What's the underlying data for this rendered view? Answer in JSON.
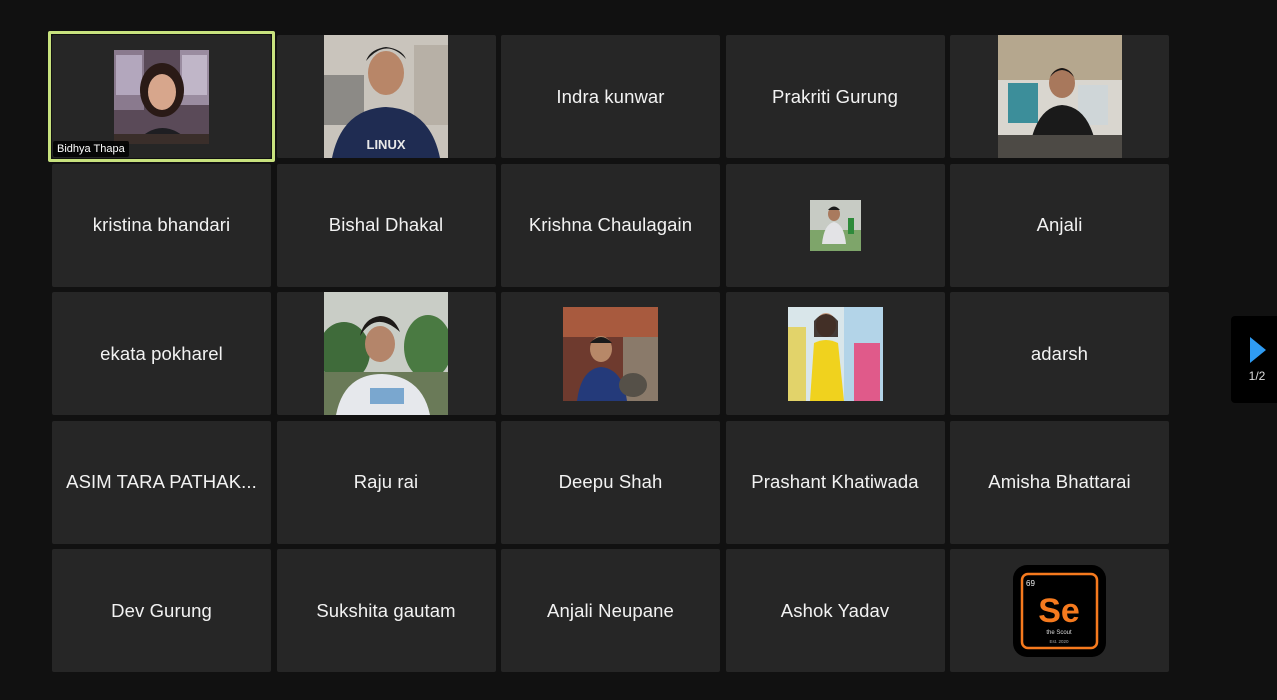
{
  "participants": [
    {
      "name": "Bidhya Thapa",
      "kind": "video",
      "active": true
    },
    {
      "name": "",
      "kind": "photo"
    },
    {
      "name": "Indra kunwar",
      "kind": "name"
    },
    {
      "name": "Prakriti Gurung",
      "kind": "name"
    },
    {
      "name": "",
      "kind": "photo"
    },
    {
      "name": "kristina bhandari",
      "kind": "name"
    },
    {
      "name": "Bishal Dhakal",
      "kind": "name"
    },
    {
      "name": "Krishna Chaulagain",
      "kind": "name"
    },
    {
      "name": "",
      "kind": "photo"
    },
    {
      "name": "Anjali",
      "kind": "name"
    },
    {
      "name": "ekata pokharel",
      "kind": "name"
    },
    {
      "name": "",
      "kind": "photo"
    },
    {
      "name": "",
      "kind": "photo"
    },
    {
      "name": "",
      "kind": "photo"
    },
    {
      "name": "adarsh",
      "kind": "name"
    },
    {
      "name": "ASIM TARA PATHAK...",
      "kind": "name"
    },
    {
      "name": "Raju rai",
      "kind": "name"
    },
    {
      "name": "Deepu Shah",
      "kind": "name"
    },
    {
      "name": "Prashant Khatiwada",
      "kind": "name"
    },
    {
      "name": "Amisha Bhattarai",
      "kind": "name"
    },
    {
      "name": "Dev Gurung",
      "kind": "name"
    },
    {
      "name": "Sukshita gautam",
      "kind": "name"
    },
    {
      "name": "Anjali Neupane",
      "kind": "name"
    },
    {
      "name": "Ashok Yadav",
      "kind": "name"
    },
    {
      "name": "",
      "kind": "logo"
    }
  ],
  "shirt_text": "LINUX",
  "logo": {
    "number": "69",
    "symbol": "Se",
    "subtitle": "the Scout",
    "footer": "Est. 2020"
  },
  "pager": {
    "label": "1/2"
  },
  "colors": {
    "background": "#111111",
    "tile": "#262626",
    "active_border": "#c8e27e",
    "pager_arrow": "#2f9bf2"
  }
}
